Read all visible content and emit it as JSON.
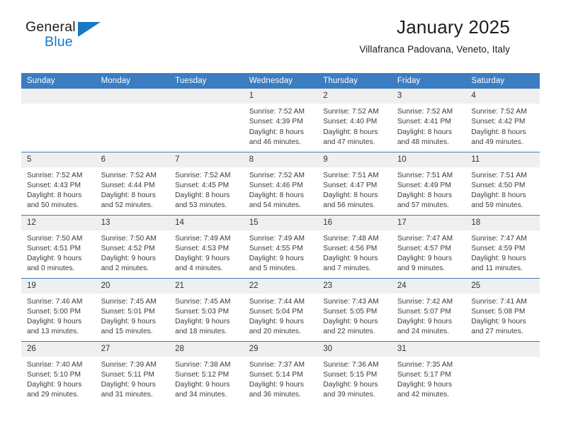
{
  "brand": {
    "name_top": "General",
    "name_bottom": "Blue",
    "accent_color": "#1878c4",
    "triangle_icon": "triangle-icon"
  },
  "header": {
    "title": "January 2025",
    "subtitle": "Villafranca Padovana, Veneto, Italy"
  },
  "theme": {
    "header_row_bg": "#3b7dc0",
    "daynum_bg": "#efefef",
    "divider": "#3b7dc0",
    "text": "#3a3a3a"
  },
  "weekday_headers": [
    "Sunday",
    "Monday",
    "Tuesday",
    "Wednesday",
    "Thursday",
    "Friday",
    "Saturday"
  ],
  "weeks": [
    [
      {
        "day": "",
        "blank": true,
        "sunrise": "",
        "sunset": "",
        "daylight_1": "",
        "daylight_2": ""
      },
      {
        "day": "",
        "blank": true,
        "sunrise": "",
        "sunset": "",
        "daylight_1": "",
        "daylight_2": ""
      },
      {
        "day": "",
        "blank": true,
        "sunrise": "",
        "sunset": "",
        "daylight_1": "",
        "daylight_2": ""
      },
      {
        "day": "1",
        "sunrise": "Sunrise: 7:52 AM",
        "sunset": "Sunset: 4:39 PM",
        "daylight_1": "Daylight: 8 hours",
        "daylight_2": "and 46 minutes."
      },
      {
        "day": "2",
        "sunrise": "Sunrise: 7:52 AM",
        "sunset": "Sunset: 4:40 PM",
        "daylight_1": "Daylight: 8 hours",
        "daylight_2": "and 47 minutes."
      },
      {
        "day": "3",
        "sunrise": "Sunrise: 7:52 AM",
        "sunset": "Sunset: 4:41 PM",
        "daylight_1": "Daylight: 8 hours",
        "daylight_2": "and 48 minutes."
      },
      {
        "day": "4",
        "sunrise": "Sunrise: 7:52 AM",
        "sunset": "Sunset: 4:42 PM",
        "daylight_1": "Daylight: 8 hours",
        "daylight_2": "and 49 minutes."
      }
    ],
    [
      {
        "day": "5",
        "sunrise": "Sunrise: 7:52 AM",
        "sunset": "Sunset: 4:43 PM",
        "daylight_1": "Daylight: 8 hours",
        "daylight_2": "and 50 minutes."
      },
      {
        "day": "6",
        "sunrise": "Sunrise: 7:52 AM",
        "sunset": "Sunset: 4:44 PM",
        "daylight_1": "Daylight: 8 hours",
        "daylight_2": "and 52 minutes."
      },
      {
        "day": "7",
        "sunrise": "Sunrise: 7:52 AM",
        "sunset": "Sunset: 4:45 PM",
        "daylight_1": "Daylight: 8 hours",
        "daylight_2": "and 53 minutes."
      },
      {
        "day": "8",
        "sunrise": "Sunrise: 7:52 AM",
        "sunset": "Sunset: 4:46 PM",
        "daylight_1": "Daylight: 8 hours",
        "daylight_2": "and 54 minutes."
      },
      {
        "day": "9",
        "sunrise": "Sunrise: 7:51 AM",
        "sunset": "Sunset: 4:47 PM",
        "daylight_1": "Daylight: 8 hours",
        "daylight_2": "and 56 minutes."
      },
      {
        "day": "10",
        "sunrise": "Sunrise: 7:51 AM",
        "sunset": "Sunset: 4:49 PM",
        "daylight_1": "Daylight: 8 hours",
        "daylight_2": "and 57 minutes."
      },
      {
        "day": "11",
        "sunrise": "Sunrise: 7:51 AM",
        "sunset": "Sunset: 4:50 PM",
        "daylight_1": "Daylight: 8 hours",
        "daylight_2": "and 59 minutes."
      }
    ],
    [
      {
        "day": "12",
        "sunrise": "Sunrise: 7:50 AM",
        "sunset": "Sunset: 4:51 PM",
        "daylight_1": "Daylight: 9 hours",
        "daylight_2": "and 0 minutes."
      },
      {
        "day": "13",
        "sunrise": "Sunrise: 7:50 AM",
        "sunset": "Sunset: 4:52 PM",
        "daylight_1": "Daylight: 9 hours",
        "daylight_2": "and 2 minutes."
      },
      {
        "day": "14",
        "sunrise": "Sunrise: 7:49 AM",
        "sunset": "Sunset: 4:53 PM",
        "daylight_1": "Daylight: 9 hours",
        "daylight_2": "and 4 minutes."
      },
      {
        "day": "15",
        "sunrise": "Sunrise: 7:49 AM",
        "sunset": "Sunset: 4:55 PM",
        "daylight_1": "Daylight: 9 hours",
        "daylight_2": "and 5 minutes."
      },
      {
        "day": "16",
        "sunrise": "Sunrise: 7:48 AM",
        "sunset": "Sunset: 4:56 PM",
        "daylight_1": "Daylight: 9 hours",
        "daylight_2": "and 7 minutes."
      },
      {
        "day": "17",
        "sunrise": "Sunrise: 7:47 AM",
        "sunset": "Sunset: 4:57 PM",
        "daylight_1": "Daylight: 9 hours",
        "daylight_2": "and 9 minutes."
      },
      {
        "day": "18",
        "sunrise": "Sunrise: 7:47 AM",
        "sunset": "Sunset: 4:59 PM",
        "daylight_1": "Daylight: 9 hours",
        "daylight_2": "and 11 minutes."
      }
    ],
    [
      {
        "day": "19",
        "sunrise": "Sunrise: 7:46 AM",
        "sunset": "Sunset: 5:00 PM",
        "daylight_1": "Daylight: 9 hours",
        "daylight_2": "and 13 minutes."
      },
      {
        "day": "20",
        "sunrise": "Sunrise: 7:45 AM",
        "sunset": "Sunset: 5:01 PM",
        "daylight_1": "Daylight: 9 hours",
        "daylight_2": "and 15 minutes."
      },
      {
        "day": "21",
        "sunrise": "Sunrise: 7:45 AM",
        "sunset": "Sunset: 5:03 PM",
        "daylight_1": "Daylight: 9 hours",
        "daylight_2": "and 18 minutes."
      },
      {
        "day": "22",
        "sunrise": "Sunrise: 7:44 AM",
        "sunset": "Sunset: 5:04 PM",
        "daylight_1": "Daylight: 9 hours",
        "daylight_2": "and 20 minutes."
      },
      {
        "day": "23",
        "sunrise": "Sunrise: 7:43 AM",
        "sunset": "Sunset: 5:05 PM",
        "daylight_1": "Daylight: 9 hours",
        "daylight_2": "and 22 minutes."
      },
      {
        "day": "24",
        "sunrise": "Sunrise: 7:42 AM",
        "sunset": "Sunset: 5:07 PM",
        "daylight_1": "Daylight: 9 hours",
        "daylight_2": "and 24 minutes."
      },
      {
        "day": "25",
        "sunrise": "Sunrise: 7:41 AM",
        "sunset": "Sunset: 5:08 PM",
        "daylight_1": "Daylight: 9 hours",
        "daylight_2": "and 27 minutes."
      }
    ],
    [
      {
        "day": "26",
        "sunrise": "Sunrise: 7:40 AM",
        "sunset": "Sunset: 5:10 PM",
        "daylight_1": "Daylight: 9 hours",
        "daylight_2": "and 29 minutes."
      },
      {
        "day": "27",
        "sunrise": "Sunrise: 7:39 AM",
        "sunset": "Sunset: 5:11 PM",
        "daylight_1": "Daylight: 9 hours",
        "daylight_2": "and 31 minutes."
      },
      {
        "day": "28",
        "sunrise": "Sunrise: 7:38 AM",
        "sunset": "Sunset: 5:12 PM",
        "daylight_1": "Daylight: 9 hours",
        "daylight_2": "and 34 minutes."
      },
      {
        "day": "29",
        "sunrise": "Sunrise: 7:37 AM",
        "sunset": "Sunset: 5:14 PM",
        "daylight_1": "Daylight: 9 hours",
        "daylight_2": "and 36 minutes."
      },
      {
        "day": "30",
        "sunrise": "Sunrise: 7:36 AM",
        "sunset": "Sunset: 5:15 PM",
        "daylight_1": "Daylight: 9 hours",
        "daylight_2": "and 39 minutes."
      },
      {
        "day": "31",
        "sunrise": "Sunrise: 7:35 AM",
        "sunset": "Sunset: 5:17 PM",
        "daylight_1": "Daylight: 9 hours",
        "daylight_2": "and 42 minutes."
      },
      {
        "day": "",
        "blank": true,
        "sunrise": "",
        "sunset": "",
        "daylight_1": "",
        "daylight_2": ""
      }
    ]
  ]
}
